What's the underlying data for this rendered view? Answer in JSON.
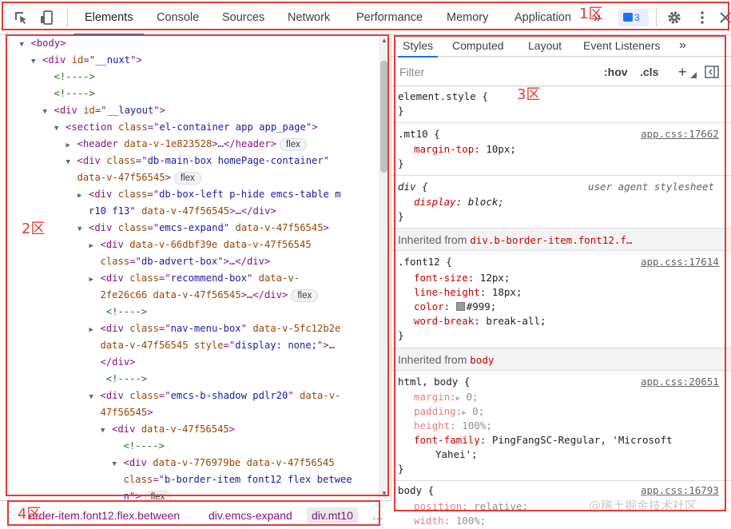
{
  "toolbar": {
    "tabs": [
      "Elements",
      "Console",
      "Sources",
      "Network",
      "Performance",
      "Memory",
      "Application"
    ],
    "more": "»",
    "issues_count": "3"
  },
  "zones": {
    "z1": "1区",
    "z2": "2区",
    "z3": "3区",
    "z4": "4区"
  },
  "elements": {
    "lines": [
      {
        "i": 1,
        "arrow": "▼",
        "html": "<span class=\"tag\">&lt;body&gt;</span>"
      },
      {
        "i": 2,
        "arrow": "▼",
        "html": "<span class=\"tag\">&lt;div</span> <span class=\"an\">id</span><span class=\"tag\">=\"</span><span class=\"av\">__nuxt</span><span class=\"tag\">\"&gt;</span>"
      },
      {
        "i": 3,
        "arrow": "",
        "html": "<span class=\"cm\">&lt;!----&gt;</span>"
      },
      {
        "i": 3,
        "arrow": "",
        "html": "<span class=\"cm\">&lt;!----&gt;</span>"
      },
      {
        "i": 3,
        "arrow": "▼",
        "html": "<span class=\"tag\">&lt;div</span> <span class=\"an\">id</span><span class=\"tag\">=\"</span><span class=\"av\">__layout</span><span class=\"tag\">\"&gt;</span>"
      },
      {
        "i": 4,
        "arrow": "▼",
        "html": "<span class=\"tag\">&lt;section</span> <span class=\"an\">class</span><span class=\"tag\">=\"</span><span class=\"av\">el-container app app_page</span><span class=\"tag\">\"&gt;</span>"
      },
      {
        "i": 5,
        "arrow": "▶",
        "html": "<span class=\"tag\">&lt;header</span> <span class=\"an\">data-v-1e823528</span><span class=\"tag\">&gt;</span><span class=\"tx\">…</span><span class=\"tag\">&lt;/header&gt;</span>",
        "chip": "flex"
      },
      {
        "i": 5,
        "arrow": "▼",
        "html": "<span class=\"tag\">&lt;div</span> <span class=\"an\">class</span><span class=\"tag\">=\"</span><span class=\"av\">db-main-box homePage-container</span><span class=\"tag\">\"</span>"
      },
      {
        "i": 5,
        "cont": true,
        "html": "<span class=\"an\">data-v-47f56545</span><span class=\"tag\">&gt;</span>",
        "chip": "flex"
      },
      {
        "i": 6,
        "arrow": "▶",
        "html": "<span class=\"tag\">&lt;div</span> <span class=\"an\">class</span><span class=\"tag\">=\"</span><span class=\"av\">db-box-left p-hide emcs-table m</span>"
      },
      {
        "i": 6,
        "cont": true,
        "html": "<span class=\"av\">r10 f13</span><span class=\"tag\">\"</span> <span class=\"an\">data-v-47f56545</span><span class=\"tag\">&gt;</span><span class=\"tx\">…</span><span class=\"tag\">&lt;/div&gt;</span>"
      },
      {
        "i": 6,
        "arrow": "▼",
        "html": "<span class=\"tag\">&lt;div</span> <span class=\"an\">class</span><span class=\"tag\">=\"</span><span class=\"av\">emcs-expand</span><span class=\"tag\">\"</span> <span class=\"an\">data-v-47f56545</span><span class=\"tag\">&gt;</span>"
      },
      {
        "i": 7,
        "arrow": "▶",
        "html": "<span class=\"tag\">&lt;div</span> <span class=\"an\">data-v-66dbf39e data-v-47f56545</span>"
      },
      {
        "i": 7,
        "cont": true,
        "html": "<span class=\"an\">class</span><span class=\"tag\">=\"</span><span class=\"av\">db-advert-box</span><span class=\"tag\">\"&gt;</span><span class=\"tx\">…</span><span class=\"tag\">&lt;/div&gt;</span>"
      },
      {
        "i": 7,
        "arrow": "▶",
        "html": "<span class=\"tag\">&lt;div</span> <span class=\"an\">class</span><span class=\"tag\">=\"</span><span class=\"av\">recommend-box</span><span class=\"tag\">\"</span> <span class=\"an\">data-v-</span>"
      },
      {
        "i": 7,
        "cont": true,
        "html": "<span class=\"an\">2fe26c66 data-v-47f56545</span><span class=\"tag\">&gt;</span><span class=\"tx\">…</span><span class=\"tag\">&lt;/div&gt;</span>",
        "chip": "flex"
      },
      {
        "i": 7.5,
        "arrow": "",
        "html": "<span class=\"cm\">&lt;!----&gt;</span>"
      },
      {
        "i": 7,
        "arrow": "▶",
        "html": "<span class=\"tag\">&lt;div</span> <span class=\"an\">class</span><span class=\"tag\">=\"</span><span class=\"av\">nav-menu-box</span><span class=\"tag\">\"</span> <span class=\"an\">data-v-5fc12b2e</span>"
      },
      {
        "i": 7,
        "cont": true,
        "html": "<span class=\"an\">data-v-47f56545</span> <span class=\"an\">style</span><span class=\"tag\">=\"</span><span class=\"av\">display: none;</span><span class=\"tag\">\"&gt;</span><span class=\"tx\">…</span>"
      },
      {
        "i": 7,
        "cont": true,
        "html": "<span class=\"tag\">&lt;/div&gt;</span>"
      },
      {
        "i": 7.5,
        "arrow": "",
        "html": "<span class=\"cm\">&lt;!----&gt;</span>"
      },
      {
        "i": 7,
        "arrow": "▼",
        "html": "<span class=\"tag\">&lt;div</span> <span class=\"an\">class</span><span class=\"tag\">=\"</span><span class=\"av\">emcs-b-shadow pdlr20</span><span class=\"tag\">\"</span> <span class=\"an\">data-v-</span>"
      },
      {
        "i": 7,
        "cont": true,
        "html": "<span class=\"an\">47f56545</span><span class=\"tag\">&gt;</span>"
      },
      {
        "i": 8,
        "arrow": "▼",
        "html": "<span class=\"tag\">&lt;div</span> <span class=\"an\">data-v-47f56545</span><span class=\"tag\">&gt;</span>"
      },
      {
        "i": 9,
        "arrow": "",
        "html": "<span class=\"cm\">&lt;!----&gt;</span>"
      },
      {
        "i": 9,
        "arrow": "▼",
        "html": "<span class=\"tag\">&lt;div</span> <span class=\"an\">data-v-776979be data-v-47f56545</span>"
      },
      {
        "i": 9,
        "cont": true,
        "html": "<span class=\"an\">class</span><span class=\"tag\">=\"</span><span class=\"av\">b-border-item font12 flex betwee</span>"
      },
      {
        "i": 9,
        "cont": true,
        "html": "<span class=\"av\">n</span><span class=\"tag\">\"&gt;</span>",
        "chip": "flex"
      }
    ]
  },
  "styles": {
    "tabs": [
      "Styles",
      "Computed",
      "Layout",
      "Event Listeners"
    ],
    "tabs_more": "»",
    "filter_placeholder": "Filter",
    "hov": ":hov",
    "cls": ".cls",
    "plus": "+",
    "element_style": "element.style {",
    "brace_close": "}",
    "rule_mt10": {
      "selector": ".mt10 {",
      "source": "app.css:17662",
      "prop": "margin-top",
      "value": "10px;"
    },
    "rule_div": {
      "selector": "div {",
      "source": "user agent stylesheet",
      "prop": "display",
      "value": "block;"
    },
    "inherited_1": {
      "label": "Inherited from ",
      "node": "div.b-border-item.font12.f…"
    },
    "rule_font12": {
      "selector": ".font12 {",
      "source": "app.css:17614",
      "props": [
        {
          "p": "font-size",
          "v": "12px;"
        },
        {
          "p": "line-height",
          "v": "18px;"
        },
        {
          "p": "color",
          "v": "#999;"
        },
        {
          "p": "word-break",
          "v": "break-all;"
        }
      ]
    },
    "inherited_2": {
      "label": "Inherited from ",
      "node": "body"
    },
    "rule_html_body": {
      "selector": "html, body {",
      "source": "app.css:20651",
      "props": [
        {
          "p": "margin",
          "v": "0;",
          "dim": true,
          "tri": true
        },
        {
          "p": "padding",
          "v": "0;",
          "dim": true,
          "tri": true
        },
        {
          "p": "height",
          "v": "100%;",
          "dim": true
        },
        {
          "p": "font-family",
          "v": "PingFangSC-Regular, 'Microsoft"
        }
      ],
      "wrap": "Yahei';"
    },
    "rule_body": {
      "selector": "body {",
      "source": "app.css:16793",
      "props": [
        {
          "p": "position",
          "v": "relative;",
          "dim": true
        },
        {
          "p": "width",
          "v": "100%;",
          "dim": true
        }
      ]
    }
  },
  "breadcrumbs": {
    "items": [
      "order-item.font12.flex.between",
      "div.emcs-expand",
      "div.mt10"
    ],
    "more": "…"
  },
  "watermark": "@稀土掘金技术社区",
  "colors": {
    "accent": "#1a73e8",
    "annotation": "#e53935"
  }
}
